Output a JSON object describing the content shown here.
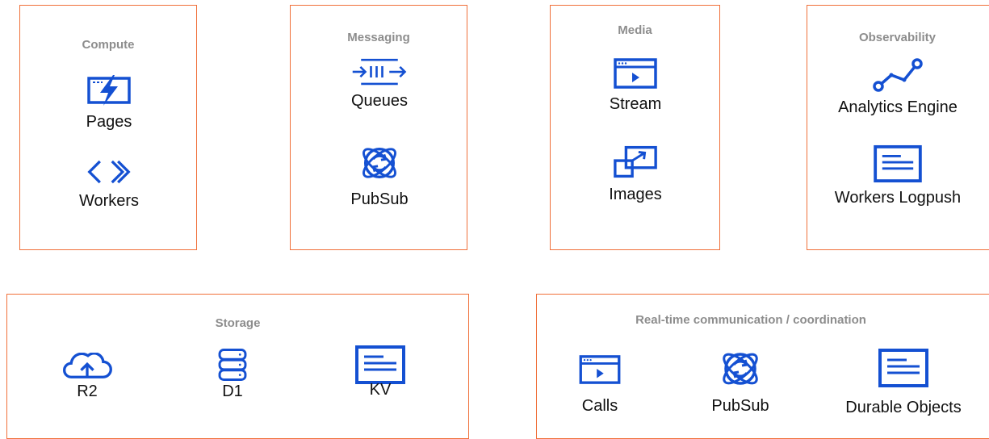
{
  "colors": {
    "border": "#f0703a",
    "icon": "#1450d2",
    "title": "#8d8d8d",
    "label": "#111111"
  },
  "compute": {
    "title": "Compute",
    "items": [
      {
        "label": "Pages",
        "icon": "lightning-window-icon"
      },
      {
        "label": "Workers",
        "icon": "code-chevrons-icon"
      }
    ]
  },
  "messaging": {
    "title": "Messaging",
    "items": [
      {
        "label": "Queues",
        "icon": "queue-icon"
      },
      {
        "label": "PubSub",
        "icon": "globe-arrows-icon"
      }
    ]
  },
  "media": {
    "title": "Media",
    "items": [
      {
        "label": "Stream",
        "icon": "video-window-icon"
      },
      {
        "label": "Images",
        "icon": "resize-frames-icon"
      }
    ]
  },
  "observability": {
    "title": "Observability",
    "items": [
      {
        "label": "Analytics Engine",
        "icon": "line-graph-icon"
      },
      {
        "label": "Workers Logpush",
        "icon": "document-lines-icon"
      }
    ]
  },
  "storage": {
    "title": "Storage",
    "items": [
      {
        "label": "R2",
        "icon": "cloud-upload-icon"
      },
      {
        "label": "D1",
        "icon": "database-stack-icon"
      },
      {
        "label": "KV",
        "icon": "document-lines-icon"
      }
    ]
  },
  "realtime": {
    "title": "Real-time communication / coordination",
    "items": [
      {
        "label": "Calls",
        "icon": "video-window-icon"
      },
      {
        "label": "PubSub",
        "icon": "globe-arrows-icon"
      },
      {
        "label": "Durable Objects",
        "icon": "document-lines-icon"
      }
    ]
  }
}
